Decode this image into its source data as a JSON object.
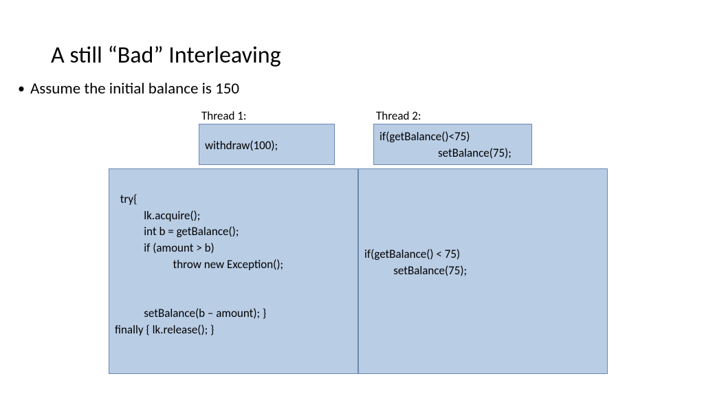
{
  "title": "A still “Bad” Interleaving",
  "bullet": "Assume the initial balance is 150",
  "thread1": {
    "label": "Thread 1:",
    "header": "withdraw(100);",
    "body": "try{\n           lk.acquire();\n           int b = getBalance();\n           if (amount > b)\n                      throw new Exception();\n\n\n           setBalance(b – amount); }\nfinally { lk.release(); }"
  },
  "thread2": {
    "label": "Thread 2:",
    "header_line1": "if(getBalance()<75)",
    "header_line2": "setBalance(75);",
    "body": "if(getBalance() < 75)\n           setBalance(75);"
  }
}
